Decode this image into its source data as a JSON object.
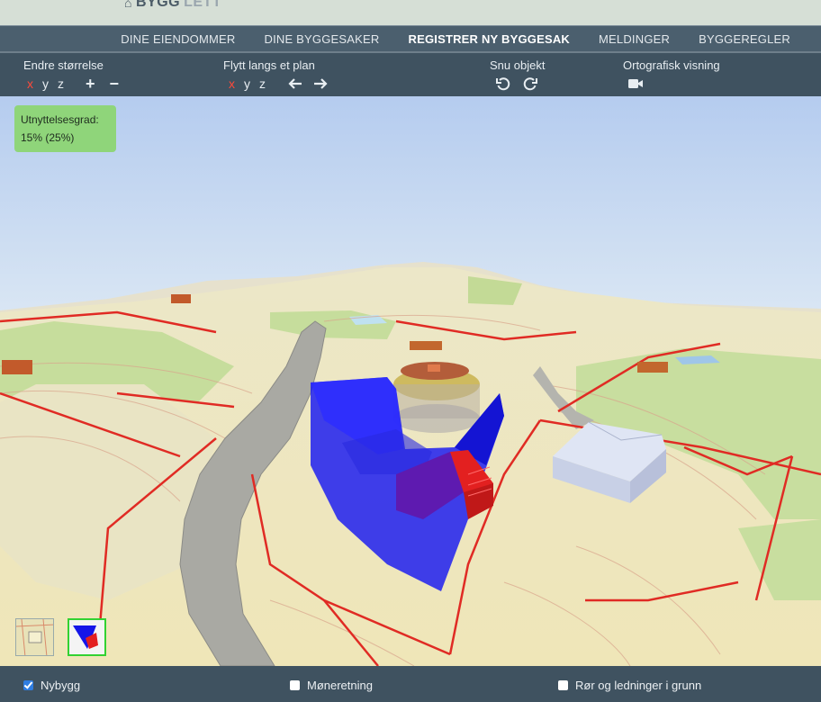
{
  "app": {
    "brand_main": "BYGG",
    "brand_rest": "LETT"
  },
  "nav": {
    "items": [
      {
        "label": "DINE EIENDOMMER",
        "active": false
      },
      {
        "label": "DINE BYGGESAKER",
        "active": false
      },
      {
        "label": "REGISTRER NY BYGGESAK",
        "active": true
      },
      {
        "label": "MELDINGER",
        "active": false
      },
      {
        "label": "BYGGEREGLER",
        "active": false
      }
    ]
  },
  "toolbar": {
    "resize": {
      "title": "Endre størrelse",
      "x": "x",
      "y": "y",
      "z": "z",
      "plus": "+",
      "minus": "−"
    },
    "move": {
      "title": "Flytt langs et plan",
      "x": "x",
      "y": "y",
      "z": "z"
    },
    "rotate": {
      "title": "Snu objekt"
    },
    "ortho": {
      "title": "Ortografisk visning"
    }
  },
  "viewport": {
    "utilization_label": "Utnyttelsesgrad:",
    "utilization_value": "15% (25%)"
  },
  "bottom": {
    "nybygg": {
      "label": "Nybygg",
      "checked": true
    },
    "moneretning": {
      "label": "Møneretning",
      "checked": false
    },
    "ror": {
      "label": "Rør og ledninger i grunn",
      "checked": false
    }
  },
  "colors": {
    "accent_red": "#ff4a3a",
    "toolbar": "#3f5260",
    "nav": "#4b5f6e",
    "volume": "#1a1aff"
  }
}
